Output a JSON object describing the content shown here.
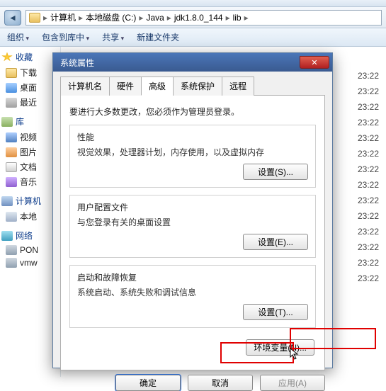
{
  "breadcrumb": [
    "计算机",
    "本地磁盘 (C:)",
    "Java",
    "jdk1.8.0_144",
    "lib"
  ],
  "toolbar": {
    "organize": "组织",
    "include": "包含到库中",
    "share": "共享",
    "newfolder": "新建文件夹"
  },
  "sidebar": {
    "favorites": {
      "title": "收藏",
      "items": [
        "下载",
        "桌面",
        "最近"
      ]
    },
    "libraries": {
      "title": "库",
      "items": [
        "视频",
        "图片",
        "文档",
        "音乐"
      ]
    },
    "computer": {
      "title": "计算机",
      "items": [
        "本地"
      ]
    },
    "network": {
      "title": "网络",
      "items": [
        "PON",
        "vmw"
      ]
    }
  },
  "time": "23:22",
  "time_count": 14,
  "dialog": {
    "title": "系统属性",
    "tabs": [
      "计算机名",
      "硬件",
      "高级",
      "系统保护",
      "远程"
    ],
    "active_tab": 2,
    "admin_note": "要进行大多数更改，您必须作为管理员登录。",
    "groups": [
      {
        "title": "性能",
        "desc": "视觉效果，处理器计划，内存使用，以及虚拟内存",
        "button": "设置(S)..."
      },
      {
        "title": "用户配置文件",
        "desc": "与您登录有关的桌面设置",
        "button": "设置(E)..."
      },
      {
        "title": "启动和故障恢复",
        "desc": "系统启动、系统失败和调试信息",
        "button": "设置(T)..."
      }
    ],
    "env_button": "环境变量(N)...",
    "buttons": {
      "ok": "确定",
      "cancel": "取消",
      "apply": "应用(A)"
    }
  }
}
